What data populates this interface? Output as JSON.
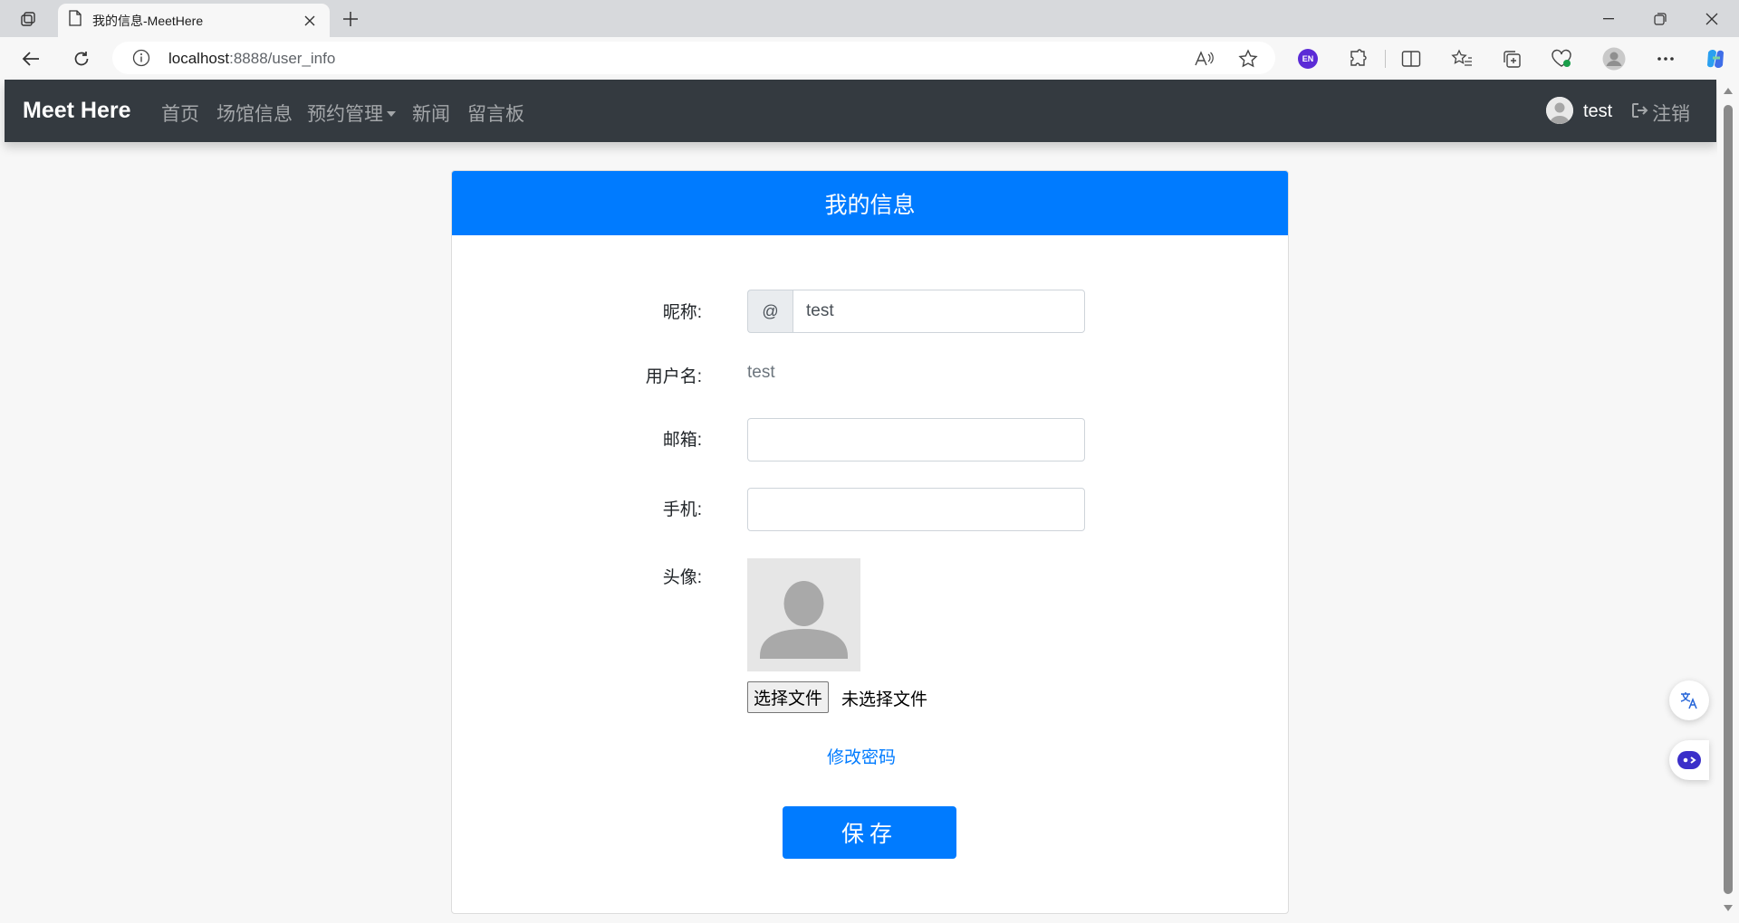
{
  "browser": {
    "tab": {
      "title": "我的信息-MeetHere"
    },
    "address": {
      "host": "localhost",
      "path": ":8888/user_info"
    },
    "icons": [
      "workspaces-icon",
      "page-icon",
      "close-icon",
      "new-tab-icon",
      "minimize-icon",
      "restore-icon",
      "window-close-icon",
      "back-icon",
      "refresh-icon",
      "info-icon",
      "read-aloud-icon",
      "favorite-star-icon",
      "extension-en-icon",
      "extensions-icon",
      "split-screen-icon",
      "favorites-icon",
      "collections-icon",
      "browser-essentials-icon",
      "profile-icon",
      "more-icon",
      "copilot-icon"
    ],
    "extension_badge": "EN"
  },
  "navbar": {
    "brand": "Meet Here",
    "items": [
      "首页",
      "场馆信息",
      "预约管理",
      "新闻",
      "留言板"
    ],
    "user": "test",
    "logout": "注销"
  },
  "card": {
    "title": "我的信息",
    "nickname": {
      "label": "昵称:",
      "prefix": "@",
      "value": "test"
    },
    "username": {
      "label": "用户名:",
      "value": "test"
    },
    "email": {
      "label": "邮箱:",
      "value": ""
    },
    "phone": {
      "label": "手机:",
      "value": ""
    },
    "avatar": {
      "label": "头像:"
    },
    "file_button": "选择文件",
    "file_status": "未选择文件",
    "change_password": "修改密码",
    "save": "保存"
  },
  "colors": {
    "navbar": "#343a40",
    "primary": "#007bff",
    "page_bg": "#f7f7f7"
  }
}
